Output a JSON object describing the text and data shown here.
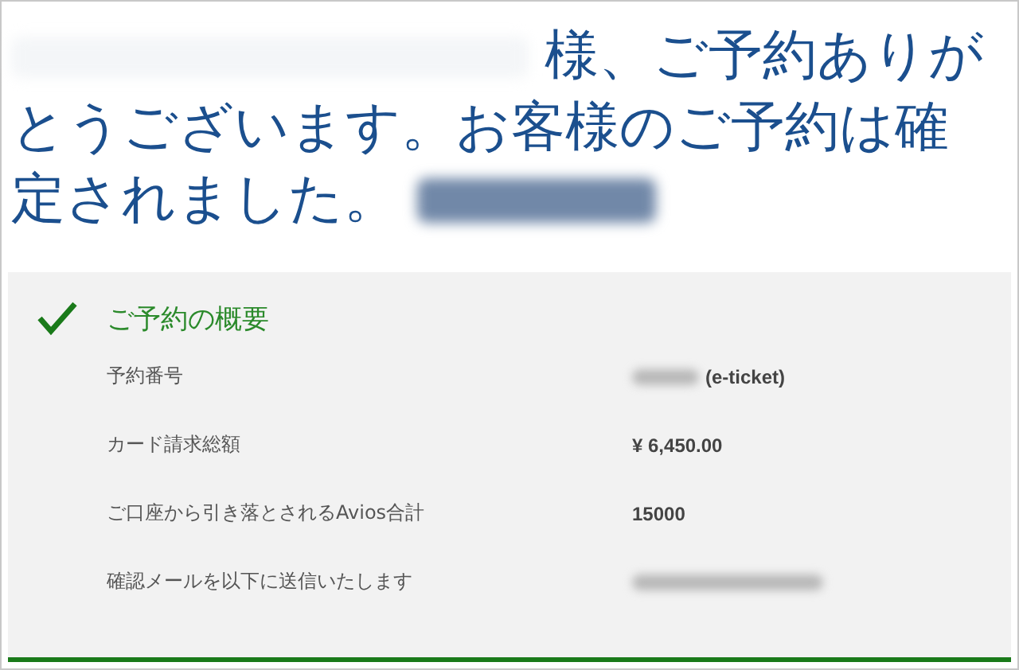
{
  "message": {
    "lines": [
      {
        "text": "様、ご予約ありが",
        "masked_before": true,
        "masked_after": false
      },
      {
        "text": "とうございます。お客様のご予約は確",
        "masked_before": false,
        "masked_after": false
      },
      {
        "text": "定されました。",
        "masked_before": false,
        "masked_after": true
      }
    ]
  },
  "summary": {
    "title": "ご予約の概要",
    "confirmed": true,
    "rows": [
      {
        "label": "予約番号",
        "value": "(e-ticket)",
        "masked": true
      },
      {
        "label": "カード請求総額",
        "value": "¥ 6,450.00",
        "masked": false
      },
      {
        "label": "ご口座から引き落とされるAvios合計",
        "value": "15000",
        "masked": false
      },
      {
        "label": "確認メールを以下に送信いたします",
        "masked": true
      }
    ]
  }
}
